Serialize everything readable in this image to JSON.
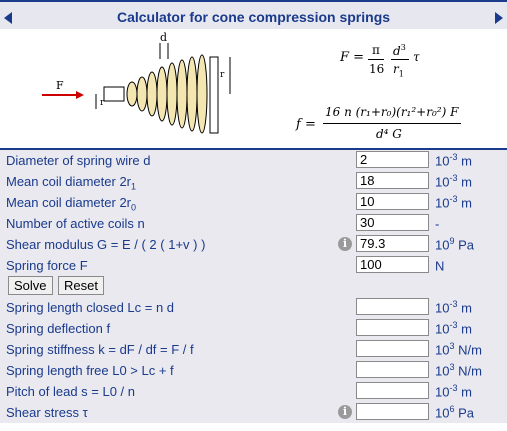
{
  "title": "Calculator for cone compression springs",
  "figure": {
    "force_label": "F",
    "d_label": "d",
    "r1_label": "r",
    "r0_label": "r"
  },
  "formulas": {
    "F": "F =",
    "pi": "π",
    "sixteen": "16",
    "d3": "d",
    "d3_exp": "3",
    "r1": "r",
    "r1_sub": "1",
    "tau": "τ",
    "f": "f =",
    "f_num": "16 n (r₁+r₀)(r₁²+r₀²) F",
    "f_den": "d⁴ G"
  },
  "inputs": [
    {
      "label": "Diameter of spring wire d",
      "value": "2",
      "unit": "10",
      "unit_exp": "-3",
      "unit_suffix": " m"
    },
    {
      "label": "Mean coil diameter 2r",
      "label_sub": "1",
      "value": "18",
      "unit": "10",
      "unit_exp": "-3",
      "unit_suffix": " m"
    },
    {
      "label": "Mean coil diameter 2r",
      "label_sub": "0",
      "value": "10",
      "unit": "10",
      "unit_exp": "-3",
      "unit_suffix": " m"
    },
    {
      "label": "Number of active coils n",
      "value": "30",
      "unit": "-",
      "unit_exp": "",
      "unit_suffix": ""
    },
    {
      "label": "Shear modulus G = E / ( 2 ( 1+v ) )",
      "value": "79.3",
      "unit": "10",
      "unit_exp": "9",
      "unit_suffix": " Pa"
    },
    {
      "label": "Spring force F",
      "value": "100",
      "unit": "N",
      "unit_exp": "",
      "unit_suffix": ""
    }
  ],
  "buttons": {
    "solve": "Solve",
    "reset": "Reset"
  },
  "outputs": [
    {
      "label": "Spring length closed Lc = n d",
      "value": "",
      "unit": "10",
      "unit_exp": "-3",
      "unit_suffix": " m"
    },
    {
      "label": "Spring deflection f",
      "value": "",
      "unit": "10",
      "unit_exp": "-3",
      "unit_suffix": " m"
    },
    {
      "label": "Spring stiffness k = dF / df = F / f",
      "value": "",
      "unit": "10",
      "unit_exp": "3",
      "unit_suffix": " N/m"
    },
    {
      "label": "Spring length free L0 > Lc + f",
      "value": "",
      "unit": "10",
      "unit_exp": "3",
      "unit_suffix": " N/m"
    },
    {
      "label": "Pitch of lead s = L0 / n",
      "value": "",
      "unit": "10",
      "unit_exp": "-3",
      "unit_suffix": " m"
    },
    {
      "label": "Shear stress τ",
      "value": "",
      "unit": "10",
      "unit_exp": "6",
      "unit_suffix": " Pa"
    }
  ],
  "info_icon": "i",
  "colors": {
    "accent": "#1a3a8c",
    "row_bg": "#e9e9ef",
    "spring": "#f4e6b0"
  }
}
